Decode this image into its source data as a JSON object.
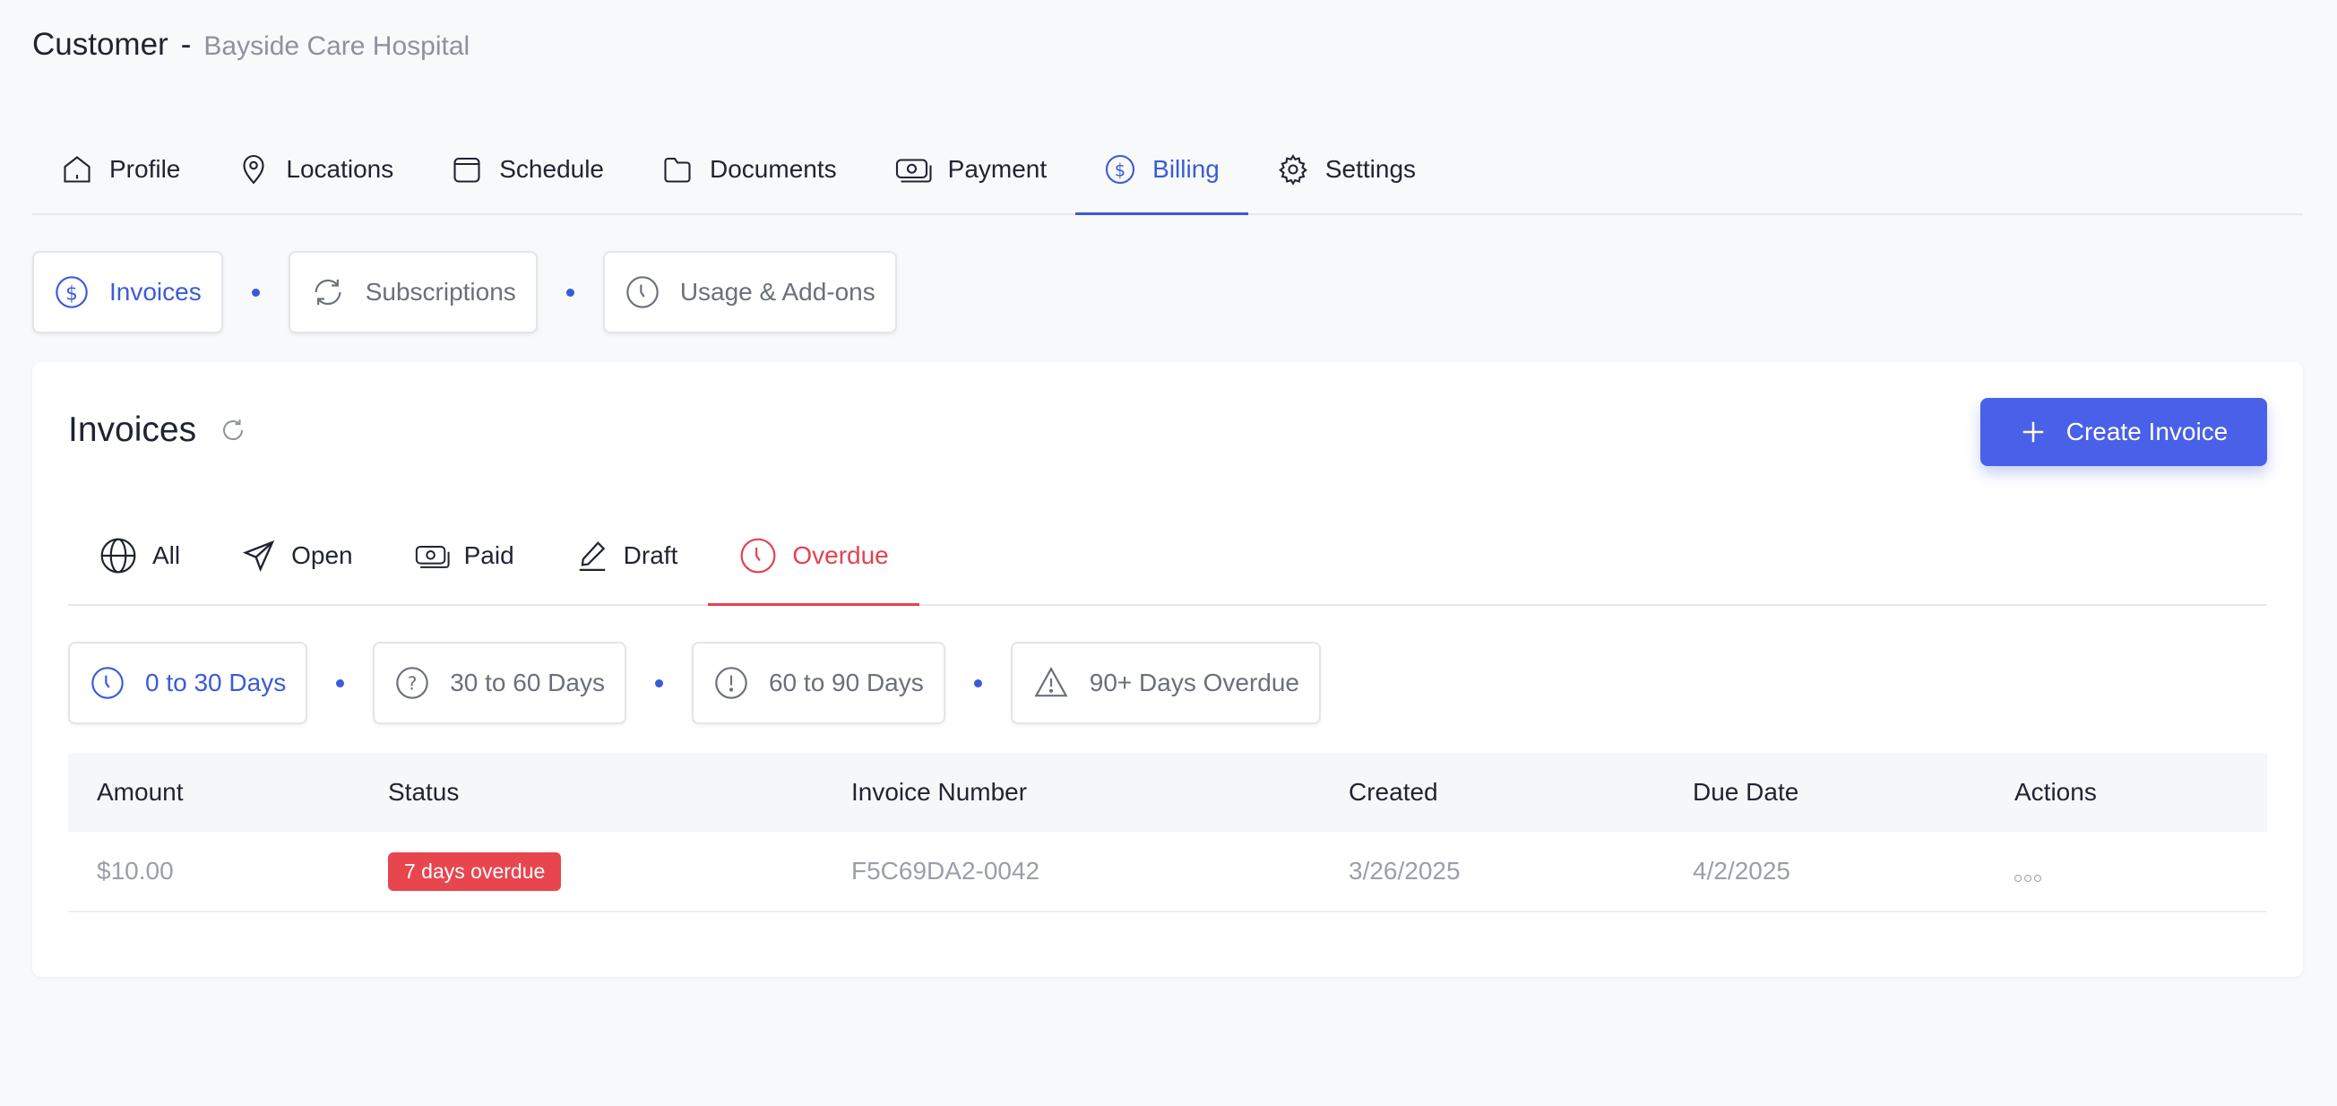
{
  "header": {
    "title": "Customer",
    "separator": "-",
    "customer_name": "Bayside Care Hospital"
  },
  "main_tabs": [
    {
      "label": "Profile",
      "icon": "home-icon"
    },
    {
      "label": "Locations",
      "icon": "map-pin-icon"
    },
    {
      "label": "Schedule",
      "icon": "calendar-icon"
    },
    {
      "label": "Documents",
      "icon": "folder-icon"
    },
    {
      "label": "Payment",
      "icon": "cash-icon"
    },
    {
      "label": "Billing",
      "icon": "dollar-circle-icon",
      "active": true
    },
    {
      "label": "Settings",
      "icon": "gear-icon"
    }
  ],
  "billing_tabs": [
    {
      "label": "Invoices",
      "icon": "dollar-circle-icon",
      "active": true
    },
    {
      "label": "Subscriptions",
      "icon": "refresh-icon"
    },
    {
      "label": "Usage & Add-ons",
      "icon": "clock-icon"
    }
  ],
  "invoices": {
    "title": "Invoices",
    "create_label": "Create Invoice",
    "status_tabs": [
      {
        "label": "All",
        "icon": "globe-icon"
      },
      {
        "label": "Open",
        "icon": "send-icon"
      },
      {
        "label": "Paid",
        "icon": "cash-icon"
      },
      {
        "label": "Draft",
        "icon": "pencil-icon"
      },
      {
        "label": "Overdue",
        "icon": "clock-icon",
        "active": true
      }
    ],
    "overdue_filters": [
      {
        "label": "0 to 30 Days",
        "icon": "clock-icon",
        "active": true
      },
      {
        "label": "30 to 60 Days",
        "icon": "question-circle-icon"
      },
      {
        "label": "60 to 90 Days",
        "icon": "exclamation-circle-icon"
      },
      {
        "label": "90+ Days Overdue",
        "icon": "warning-triangle-icon"
      }
    ],
    "table": {
      "columns": [
        "Amount",
        "Status",
        "Invoice Number",
        "Created",
        "Due Date",
        "Actions"
      ],
      "rows": [
        {
          "amount": "$10.00",
          "status": "7 days overdue",
          "invoice_number": "F5C69DA2-0042",
          "created": "3/26/2025",
          "due_date": "4/2/2025"
        }
      ]
    }
  },
  "colors": {
    "accent": "#3a5bd9",
    "button": "#4960e8",
    "overdue": "#e2434f",
    "badge": "#e8464f"
  }
}
